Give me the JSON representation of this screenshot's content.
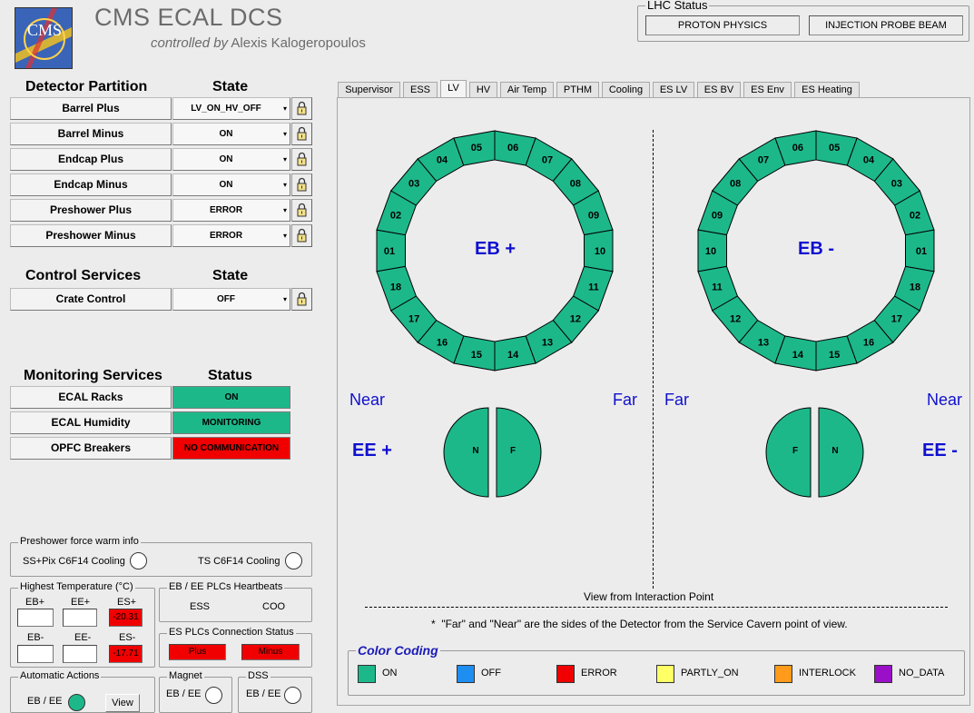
{
  "header": {
    "title": "CMS ECAL DCS",
    "controlled_by": "controlled by",
    "operator": "Alexis Kalogeropoulos",
    "logo_text": "CMS"
  },
  "lhc": {
    "title": "LHC Status",
    "mode": "PROTON PHYSICS",
    "beam": "INJECTION PROBE BEAM"
  },
  "detector": {
    "heading": "Detector Partition",
    "state_heading": "State",
    "rows": [
      {
        "label": "Barrel Plus",
        "state": "LV_ON_HV_OFF"
      },
      {
        "label": "Barrel Minus",
        "state": "ON"
      },
      {
        "label": "Endcap Plus",
        "state": "ON"
      },
      {
        "label": "Endcap Minus",
        "state": "ON"
      },
      {
        "label": "Preshower Plus",
        "state": "ERROR"
      },
      {
        "label": "Preshower Minus",
        "state": "ERROR"
      }
    ]
  },
  "control": {
    "heading": "Control Services",
    "state_heading": "State",
    "rows": [
      {
        "label": "Crate Control",
        "state": "OFF"
      }
    ]
  },
  "monitoring": {
    "heading": "Monitoring Services",
    "status_heading": "Status",
    "rows": [
      {
        "label": "ECAL Racks",
        "status": "ON",
        "color": "#1db88a"
      },
      {
        "label": "ECAL Humidity",
        "status": "MONITORING",
        "color": "#1db88a"
      },
      {
        "label": "OPFC Breakers",
        "status": "NO COMMUNICATION",
        "color": "#f00000"
      }
    ]
  },
  "preshower_warm": {
    "title": "Preshower force warm info",
    "left_label": "SS+Pix C6F14 Cooling",
    "right_label": "TS C6F14 Cooling"
  },
  "highest_temp": {
    "title": "Highest Temperature (°C)",
    "labels": [
      "EB+",
      "EE+",
      "ES+",
      "EB-",
      "EE-",
      "ES-"
    ],
    "values": [
      "",
      "",
      "-20.31",
      "",
      "",
      "-17.71"
    ]
  },
  "plc_heartbeats": {
    "title": "EB / EE PLCs Heartbeats",
    "left": "ESS",
    "right": "COO"
  },
  "es_plc": {
    "title": "ES PLCs Connection Status",
    "plus": "Plus",
    "minus": "Minus"
  },
  "auto_actions": {
    "title": "Automatic Actions",
    "label": "EB / EE",
    "button": "View"
  },
  "magnet": {
    "title": "Magnet",
    "label": "EB / EE"
  },
  "dss": {
    "title": "DSS",
    "label": "EB / EE"
  },
  "tabs": [
    "Supervisor",
    "ESS",
    "LV",
    "HV",
    "Air Temp",
    "PTHM",
    "Cooling",
    "ES LV",
    "ES BV",
    "ES Env",
    "ES Heating"
  ],
  "active_tab": "LV",
  "barrel": {
    "eb_plus_label": "EB +",
    "eb_minus_label": "EB -",
    "sector_color": "#1db88a",
    "eb_plus_sectors": [
      "01",
      "02",
      "03",
      "04",
      "05",
      "06",
      "07",
      "08",
      "09",
      "10",
      "11",
      "12",
      "13",
      "14",
      "15",
      "16",
      "17",
      "18"
    ],
    "eb_minus_sectors": [
      "01",
      "02",
      "03",
      "04",
      "05",
      "06",
      "07",
      "08",
      "09",
      "10",
      "11",
      "12",
      "13",
      "14",
      "15",
      "16",
      "17",
      "18"
    ]
  },
  "endcap": {
    "near": "Near",
    "far": "Far",
    "ee_plus_label": "EE +",
    "ee_minus_label": "EE -",
    "n": "N",
    "f": "F"
  },
  "view_from": "View from Interaction Point",
  "footnote": "*  \"Far\" and \"Near\" are the sides of the Detector from the Service Cavern point of view.",
  "color_coding": {
    "title": "Color Coding",
    "items": [
      {
        "label": "ON",
        "color": "#1db88a"
      },
      {
        "label": "OFF",
        "color": "#1e8ef0"
      },
      {
        "label": "ERROR",
        "color": "#f00000"
      },
      {
        "label": "PARTLY_ON",
        "color": "#ffff66"
      },
      {
        "label": "INTERLOCK",
        "color": "#ff9a1a"
      },
      {
        "label": "NO_DATA",
        "color": "#9a10c8"
      }
    ]
  }
}
